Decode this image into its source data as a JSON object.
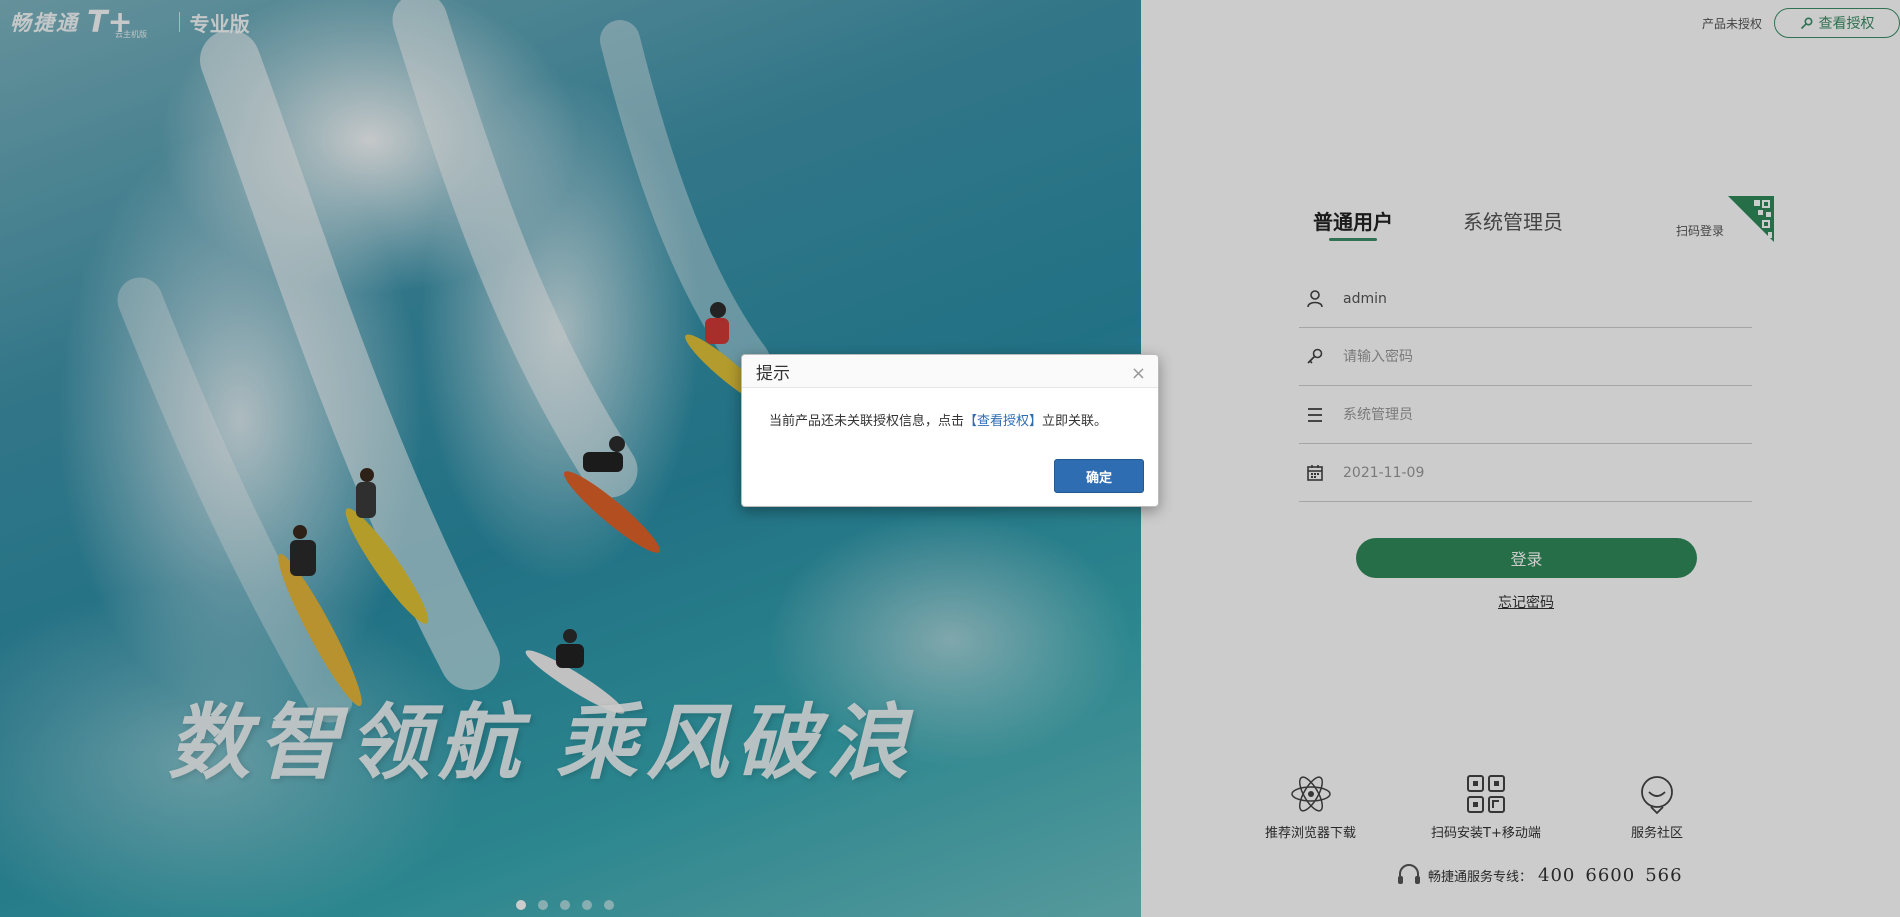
{
  "brand": {
    "name": "畅捷通",
    "product": "T+",
    "cloud_tag": "云主机版",
    "edition": "专业版"
  },
  "hero": {
    "slogan_part1": "数智领航",
    "slogan_part2": "乘风破浪",
    "carousel_count": 5,
    "carousel_active": 1
  },
  "topbar": {
    "unlicensed_text": "产品未授权",
    "view_license_label": "查看授权"
  },
  "login": {
    "tabs": [
      {
        "label": "普通用户",
        "active": true
      },
      {
        "label": "系统管理员",
        "active": false
      }
    ],
    "scan_login_label": "扫码登录",
    "username_value": "admin",
    "password_placeholder": "请输入密码",
    "account_set_placeholder": "系统管理员",
    "date_placeholder": "2021-11-09",
    "login_button": "登录",
    "forgot_password": "忘记密码"
  },
  "services": [
    {
      "label": "推荐浏览器下载",
      "icon": "atom-icon"
    },
    {
      "label": "扫码安装T+移动端",
      "icon": "qr-code-icon"
    },
    {
      "label": "服务社区",
      "icon": "community-icon"
    }
  ],
  "hotline": {
    "label": "畅捷通服务专线：",
    "number_parts": [
      "400",
      "6600",
      "566"
    ]
  },
  "dialog": {
    "title": "提示",
    "message_before": "当前产品还未关联授权信息，点击",
    "link_text": "【查看授权】",
    "message_after": "立即关联。",
    "ok_button": "确定"
  },
  "colors": {
    "accent_green": "#2f8a5b",
    "dialog_blue": "#2f6db3"
  }
}
